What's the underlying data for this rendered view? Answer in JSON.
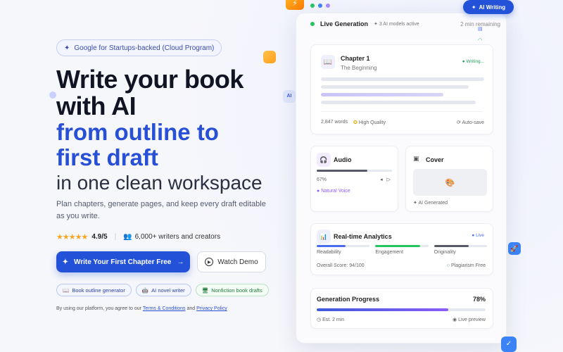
{
  "hero": {
    "badge": "Google for Startups-backed (Cloud Program)",
    "title_line1": "Write your book",
    "title_line2": "with AI",
    "title_blue1": "from outline to",
    "title_blue2": "first draft",
    "title_light": "in one clean workspace",
    "subtitle": "Plan chapters, generate pages, and keep every draft editable as you write.",
    "rating": "4.9/5",
    "users": "6,000+ writers and creators",
    "cta_primary": "Write Your First Chapter Free",
    "cta_secondary": "Watch Demo",
    "chips": [
      "Book outline generator",
      "AI novel writer",
      "Nonfiction book drafts"
    ],
    "legal_prefix": "By using our platform, you agree to our",
    "legal_terms": "Terms & Conditions",
    "legal_and": "and",
    "legal_privacy": "Privacy Policy"
  },
  "panel": {
    "floating_tag": "AI Writing",
    "ai_chip": "AI",
    "header": {
      "title": "Live Generation",
      "models": "3 AI models active",
      "remaining": "2 min remaining"
    },
    "chapter": {
      "title": "Chapter 1",
      "subtitle": "The Beginning",
      "status": "Writing...",
      "words": "2,847 words",
      "quality": "High Quality",
      "autosave": "Auto-save"
    },
    "audio": {
      "title": "Audio",
      "percent": "67%",
      "progress": 0.67,
      "voice": "Natural Voice"
    },
    "cover": {
      "title": "Cover",
      "status": "AI Generated"
    },
    "analytics": {
      "title": "Real-time Analytics",
      "live": "Live",
      "metrics": [
        {
          "label": "Readability",
          "value": 0.55,
          "color": "#4a6cf0"
        },
        {
          "label": "Engagement",
          "value": 0.85,
          "color": "#22c55e"
        },
        {
          "label": "Originality",
          "value": 0.65,
          "color": "#555a66"
        }
      ],
      "overall": "Overall Score: 94/100",
      "plagiarism": "Plagiarism Free"
    },
    "progress": {
      "title": "Generation Progress",
      "percent": "78%",
      "value": 0.78,
      "est": "Est. 2 min",
      "preview": "Live preview"
    }
  },
  "colors": {
    "accent": "#2352d8",
    "green": "#22c55e",
    "purple": "#8b5cf6"
  }
}
